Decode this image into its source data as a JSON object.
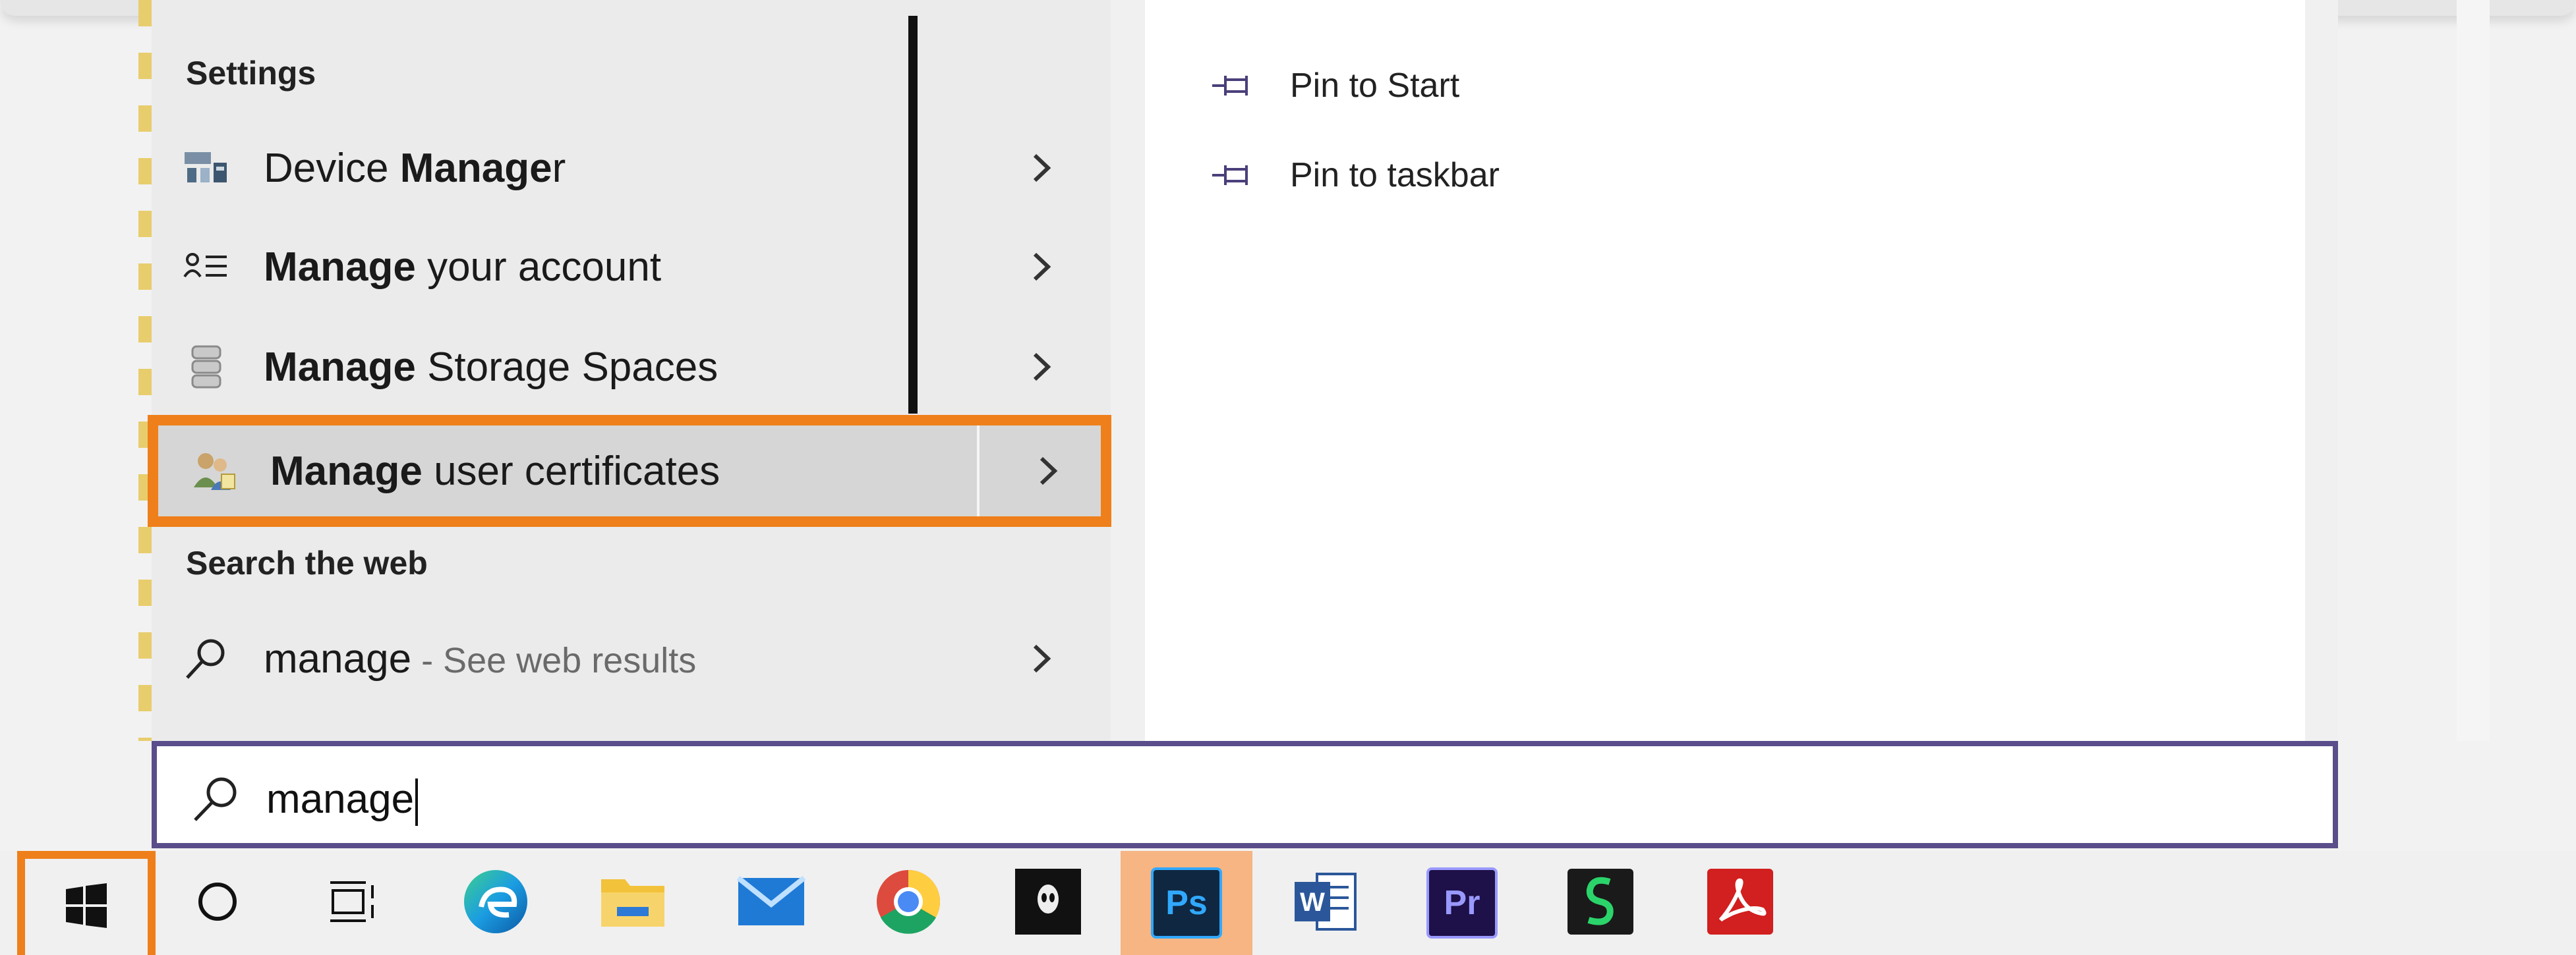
{
  "menu": {
    "sections": {
      "settings": "Settings",
      "web": "Search the web"
    },
    "results": [
      {
        "bold_prefix": "",
        "bold": "Manage",
        "prefix": "Device ",
        "suffix": "r",
        "icon": "device-manager-icon"
      },
      {
        "bold": "Manage",
        "rest": " your account",
        "icon": "account-icon"
      },
      {
        "bold": "Manage",
        "rest": " Storage Spaces",
        "icon": "storage-icon"
      },
      {
        "bold": "Manage",
        "rest": " user certificates",
        "icon": "certificates-icon"
      }
    ],
    "web_result": {
      "query": "manage",
      "hint": " - See web results",
      "icon": "search-icon"
    }
  },
  "detail": {
    "actions": [
      {
        "label": "Pin to Start",
        "icon": "pin-icon"
      },
      {
        "label": "Pin to taskbar",
        "icon": "pin-icon"
      }
    ]
  },
  "search": {
    "value": "manage"
  },
  "taskbar": {
    "ps_label": "Ps",
    "pr_label": "Pr",
    "word_label": "W"
  },
  "colors": {
    "highlight": "#ef7f1a",
    "search_border": "#5a4d8a",
    "ps_hover": "#f6b582"
  }
}
